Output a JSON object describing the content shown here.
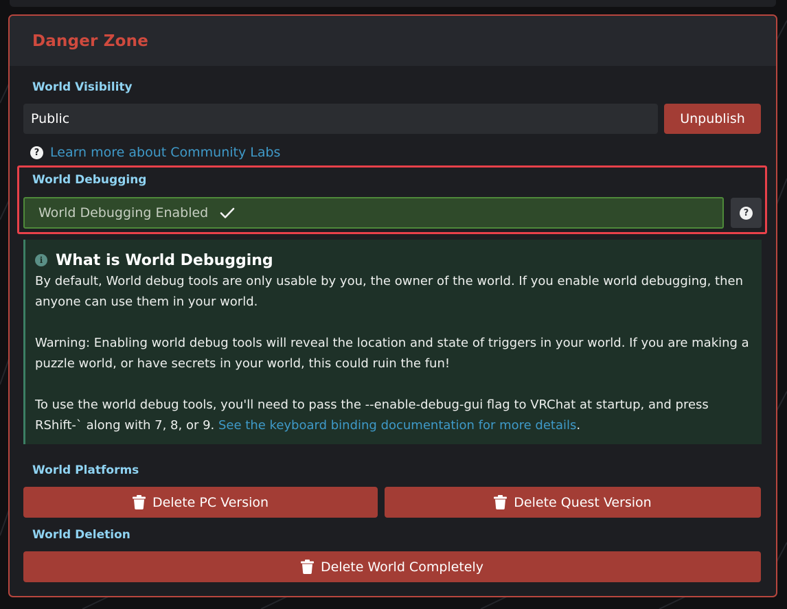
{
  "danger_zone": {
    "title": "Danger Zone"
  },
  "visibility": {
    "label": "World Visibility",
    "value": "Public",
    "unpublish_label": "Unpublish",
    "learn_more_link": "Learn more about Community Labs"
  },
  "debugging": {
    "label": "World Debugging",
    "status": "World Debugging Enabled"
  },
  "info": {
    "title": "What is World Debugging",
    "paragraph_1": "By default, World debug tools are only usable by you, the owner of the world. If you enable world debugging, then anyone can use them in your world.",
    "paragraph_2": "Warning: Enabling world debug tools will reveal the location and state of triggers in your world. If you are making a puzzle world, or have secrets in your world, this could ruin the fun!",
    "paragraph_3_text": "To use the world debug tools, you'll need to pass the --enable-debug-gui flag to VRChat at startup, and press RShift-` along with 7, 8, or 9.",
    "paragraph_3_link": "See the keyboard binding documentation for more details",
    "paragraph_3_end": "."
  },
  "platforms": {
    "label": "World Platforms",
    "delete_pc": "Delete PC Version",
    "delete_quest": "Delete Quest Version"
  },
  "deletion": {
    "label": "World Deletion",
    "delete_world": "Delete World Completely"
  },
  "colors": {
    "danger_accent": "#cf4a3e",
    "label_blue": "#8fd3f2",
    "link_blue": "#3f9ac9",
    "button_red": "#a33d35",
    "success_green": "#2f4a2a",
    "highlight_red": "#e8414a"
  },
  "icons": {
    "help": "question-circle-icon",
    "info": "info-circle-icon",
    "check": "checkmark-icon",
    "trash": "trash-icon"
  }
}
